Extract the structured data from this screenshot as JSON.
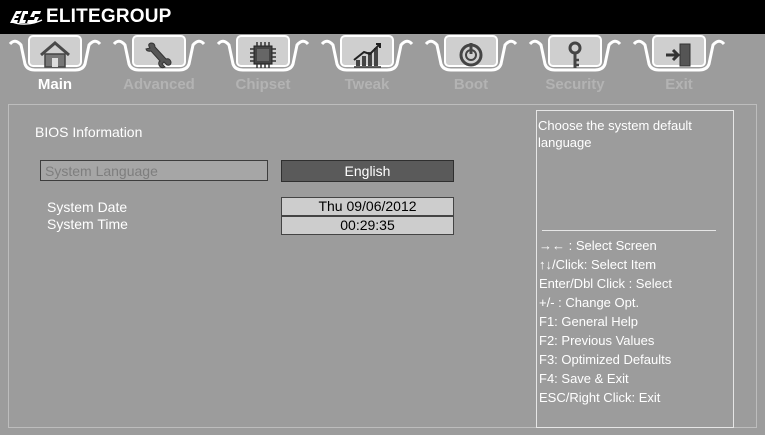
{
  "brand": {
    "name": "ELITEGROUP",
    "logo_text": "ECS"
  },
  "tabs": [
    {
      "label": "Main",
      "icon": "home-icon",
      "active": true
    },
    {
      "label": "Advanced",
      "icon": "wrench-icon",
      "active": false
    },
    {
      "label": "Chipset",
      "icon": "chip-icon",
      "active": false
    },
    {
      "label": "Tweak",
      "icon": "graph-icon",
      "active": false
    },
    {
      "label": "Boot",
      "icon": "power-icon",
      "active": false
    },
    {
      "label": "Security",
      "icon": "key-icon",
      "active": false
    },
    {
      "label": "Exit",
      "icon": "exit-icon",
      "active": false
    }
  ],
  "main": {
    "bios_info": "BIOS Information",
    "language": {
      "label": "System Language",
      "value": "English"
    },
    "date": {
      "label": "System Date",
      "value": "Thu 09/06/2012"
    },
    "time": {
      "label": "System Time",
      "value": "00:29:35"
    }
  },
  "help": {
    "description": "Choose the system default language",
    "keys": [
      "→←  : Select Screen",
      "↑↓/Click: Select Item",
      "Enter/Dbl Click : Select",
      "+/- : Change Opt.",
      "F1: General Help",
      "F2: Previous Values",
      "F3: Optimized Defaults",
      "F4: Save & Exit",
      "ESC/Right Click: Exit"
    ]
  },
  "colors": {
    "background": "#9c9c9c",
    "topbar": "#000000",
    "active_label": "#ffffff",
    "inactive_label": "#b3b3b3",
    "selected_value_bg": "#5a5a5a"
  }
}
